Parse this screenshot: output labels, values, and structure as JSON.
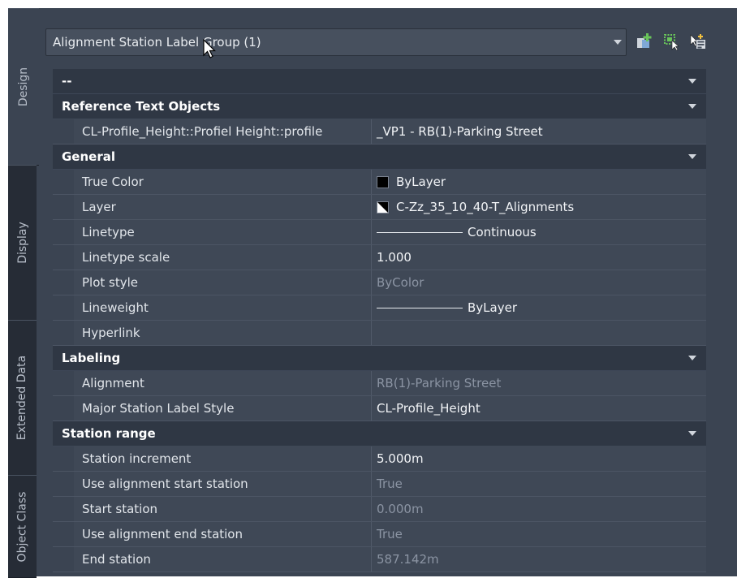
{
  "side_tabs": [
    {
      "label": "Design",
      "active": true
    },
    {
      "label": "Display",
      "active": false
    },
    {
      "label": "Extended Data",
      "active": false
    },
    {
      "label": "Object Class",
      "active": false
    }
  ],
  "selection_dropdown": {
    "value": "Alignment Station Label Group (1)"
  },
  "toolbar_icons": [
    "quick-select-icon",
    "select-objects-icon",
    "toggle-pickadd-icon"
  ],
  "colors": {
    "panel_bg": "#3b4452",
    "category_bg": "#2f3744",
    "property_bg": "#3f4856",
    "accent_green": "#69c45a"
  },
  "sections": {
    "top": {
      "title": "--"
    },
    "reference": {
      "title": "Reference Text Objects",
      "rows": [
        {
          "name": "CL-Profile_Height::Profiel Height::profile",
          "value": "_VP1 - RB(1)-Parking Street"
        }
      ]
    },
    "general": {
      "title": "General",
      "rows": [
        {
          "name": "True Color",
          "value": "ByLayer"
        },
        {
          "name": "Layer",
          "value": "C-Zz_35_10_40-T_Alignments"
        },
        {
          "name": "Linetype",
          "value": "Continuous"
        },
        {
          "name": "Linetype scale",
          "value": "1.000"
        },
        {
          "name": "Plot style",
          "value": "ByColor"
        },
        {
          "name": "Lineweight",
          "value": "ByLayer"
        },
        {
          "name": "Hyperlink",
          "value": ""
        }
      ]
    },
    "labeling": {
      "title": "Labeling",
      "rows": [
        {
          "name": "Alignment",
          "value": "RB(1)-Parking Street"
        },
        {
          "name": "Major Station Label Style",
          "value": "CL-Profile_Height"
        }
      ]
    },
    "station": {
      "title": "Station range",
      "rows": [
        {
          "name": "Station increment",
          "value": "5.000m"
        },
        {
          "name": "Use alignment start station",
          "value": "True"
        },
        {
          "name": "Start station",
          "value": "0.000m"
        },
        {
          "name": "Use alignment end station",
          "value": "True"
        },
        {
          "name": "End station",
          "value": "587.142m"
        }
      ]
    }
  }
}
